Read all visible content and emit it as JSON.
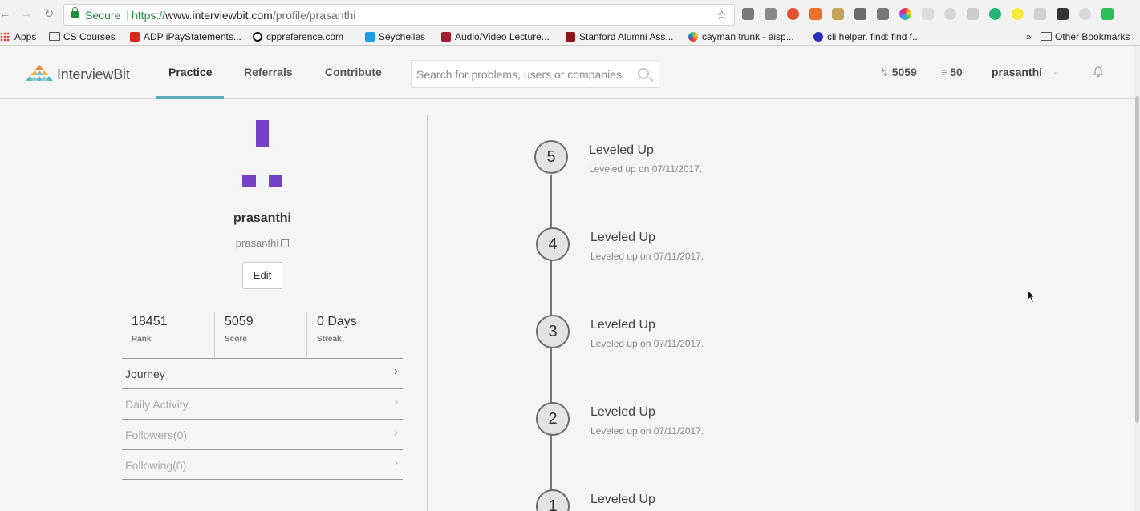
{
  "browser": {
    "secure_label": "Secure",
    "url_scheme": "https://",
    "url_host": "www.interviewbit.com",
    "url_path": "/profile/prasanthi"
  },
  "bookmarks": {
    "items": [
      {
        "label": "Apps"
      },
      {
        "label": "CS Courses"
      },
      {
        "label": "ADP iPayStatements..."
      },
      {
        "label": "cppreference.com"
      },
      {
        "label": "Seychelles"
      },
      {
        "label": "Audio/Video Lecture..."
      },
      {
        "label": "Stanford Alumni Ass..."
      },
      {
        "label": "cayman trunk - aisp..."
      },
      {
        "label": "cli helper. find: find f..."
      }
    ],
    "overflow": "»",
    "other": "Other Bookmarks"
  },
  "header": {
    "logo_text": "InterviewBit",
    "nav": [
      {
        "label": "Practice"
      },
      {
        "label": "Referrals"
      },
      {
        "label": "Contribute"
      }
    ],
    "search_placeholder": "Search for problems, users or companies",
    "score": "5059",
    "coins": "50",
    "username": "prasanthi"
  },
  "profile": {
    "name": "prasanthi",
    "handle": "prasanthi",
    "edit_label": "Edit",
    "stats": [
      {
        "value": "18451",
        "label": "Rank"
      },
      {
        "value": "5059",
        "label": "Score"
      },
      {
        "value": "0 Days",
        "label": "Streak"
      }
    ],
    "menu": [
      {
        "label": "Journey"
      },
      {
        "label": "Daily Activity"
      },
      {
        "label": "Followers(0)"
      },
      {
        "label": "Following(0)"
      }
    ]
  },
  "timeline": [
    {
      "level": "5",
      "title": "Leveled Up",
      "subtitle": "Leveled up on 07/11/2017."
    },
    {
      "level": "4",
      "title": "Leveled Up",
      "subtitle": "Leveled up on 07/11/2017."
    },
    {
      "level": "3",
      "title": "Leveled Up",
      "subtitle": "Leveled up on 07/11/2017."
    },
    {
      "level": "2",
      "title": "Leveled Up",
      "subtitle": "Leveled up on 07/11/2017."
    },
    {
      "level": "1",
      "title": "Leveled Up",
      "subtitle": ""
    }
  ],
  "colors": {
    "accent": "#5aa9c0",
    "avatar": "#7243c9",
    "secure_green": "#1e8e3e"
  }
}
